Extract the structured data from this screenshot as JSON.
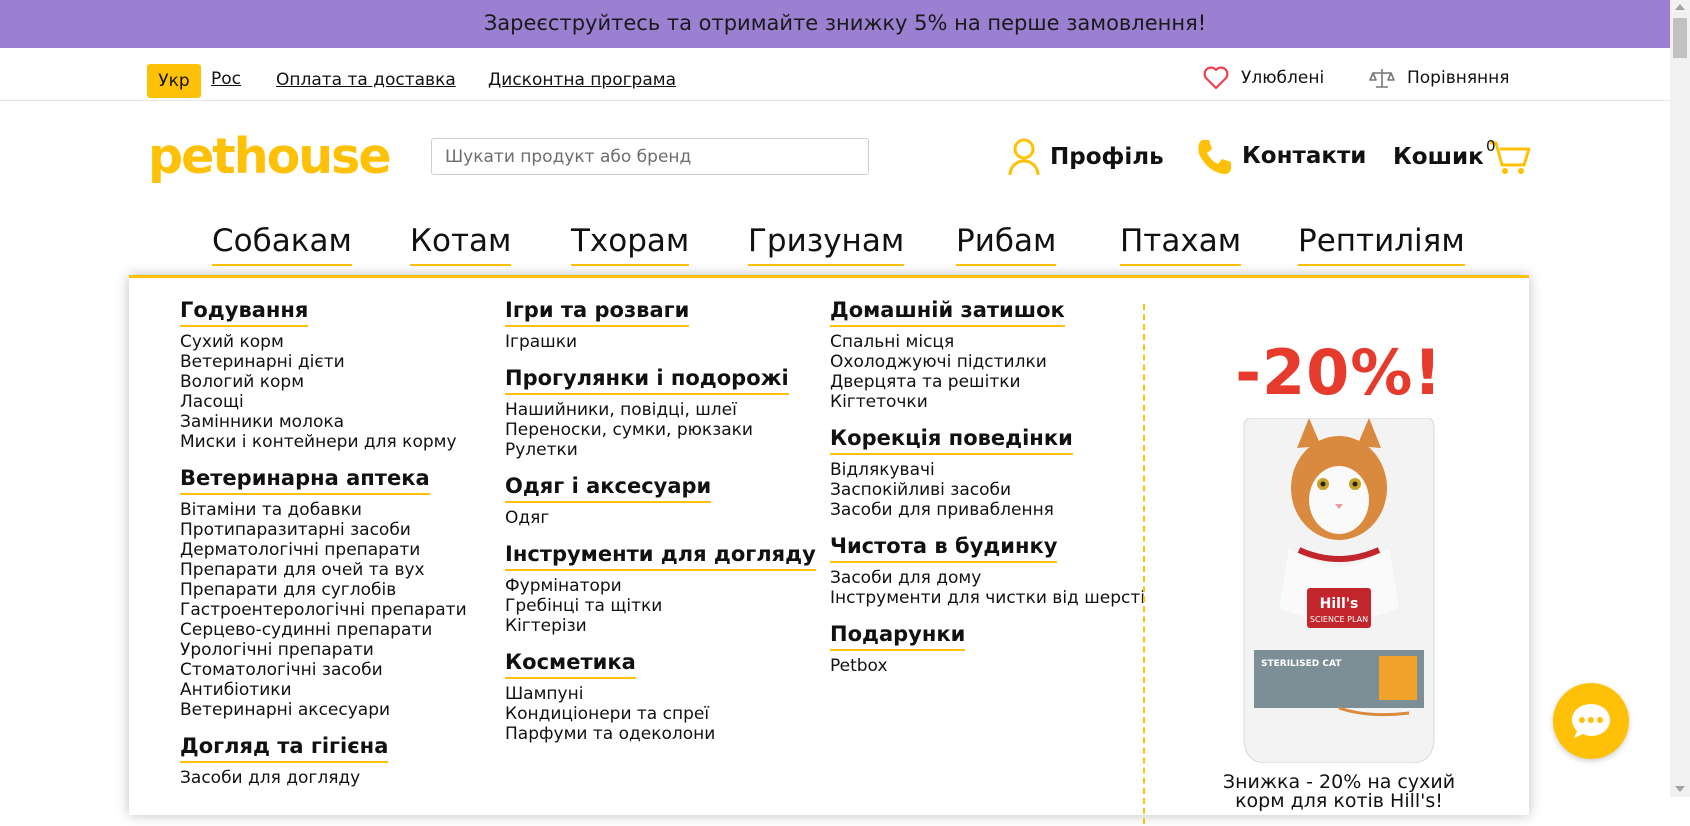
{
  "promo_banner": "Зареєструйтесь та отримайте знижку 5% на перше замовлення!",
  "topbar": {
    "lang_active": "Укр",
    "lang_other": "Рос",
    "delivery": "Оплата та доставка",
    "discount": "Дисконтна програма",
    "favorites": "Улюблені",
    "compare": "Порівняння"
  },
  "header": {
    "logo_text": "pethouse",
    "search_placeholder": "Шукати продукт або бренд",
    "profile": "Профіль",
    "contacts": "Контакти",
    "cart": "Кошик",
    "cart_count": "0"
  },
  "nav": [
    "Собакам",
    "Котам",
    "Тхорам",
    "Гризунам",
    "Рибам",
    "Птахам",
    "Рептиліям"
  ],
  "menu": {
    "col1": [
      {
        "title": "Годування",
        "links": [
          "Сухий корм",
          "Ветеринарні дієти",
          "Вологий корм",
          "Ласощі",
          "Замінники молока",
          "Миски і контейнери для корму"
        ]
      },
      {
        "title": "Ветеринарна аптека",
        "links": [
          "Вітаміни та добавки",
          "Протипаразитарні засоби",
          "Дерматологічні препарати",
          "Препарати для очей та вух",
          "Препарати для суглобів",
          "Гастроентерологічні препарати",
          "Серцево-судинні препарати",
          "Урологічні препарати",
          "Стоматологічні засоби",
          "Антибіотики",
          "Ветеринарні аксесуари"
        ]
      },
      {
        "title": "Догляд та гігієна",
        "links": [
          "Засоби для догляду"
        ]
      }
    ],
    "col2": [
      {
        "title": "Ігри та розваги",
        "links": [
          "Іграшки"
        ]
      },
      {
        "title": "Прогулянки і подорожі",
        "links": [
          "Нашийники, повідці, шлеї",
          "Переноски, сумки, рюкзаки",
          "Рулетки"
        ]
      },
      {
        "title": "Одяг і аксесуари",
        "links": [
          "Одяг"
        ]
      },
      {
        "title": "Інструменти для догляду",
        "links": [
          "Фурмінатори",
          "Гребінці та щітки",
          "Кігтерізи"
        ]
      },
      {
        "title": "Косметика",
        "links": [
          "Шампуні",
          "Кондиціонери та спреї",
          "Парфуми та одеколони"
        ]
      }
    ],
    "col3": [
      {
        "title": "Домашній затишок",
        "links": [
          "Спальні місця",
          "Охолоджуючі підстилки",
          "Дверцята та решітки",
          "Кігтеточки"
        ]
      },
      {
        "title": "Корекція поведінки",
        "links": [
          "Відлякувачі",
          "Заспокійливі засоби",
          "Засоби для приваблення"
        ]
      },
      {
        "title": "Чистота в будинку",
        "links": [
          "Засоби для дому",
          "Інструменти для чистки від шерсті"
        ]
      },
      {
        "title": "Подарунки",
        "links": [
          "Petbox"
        ]
      }
    ]
  },
  "promo": {
    "percent": "-20%!",
    "caption_line1": "Знижка - 20% на сухий",
    "caption_line2": "корм для котів Hill's!",
    "bag_brand": "Hill's",
    "bag_line": "SCIENCE PLAN",
    "bag_product": "STERILISED CAT"
  },
  "colors": {
    "accent": "#ffc107",
    "promo_bar": "#9b7fd0",
    "discount_red": "#e63a2c"
  }
}
